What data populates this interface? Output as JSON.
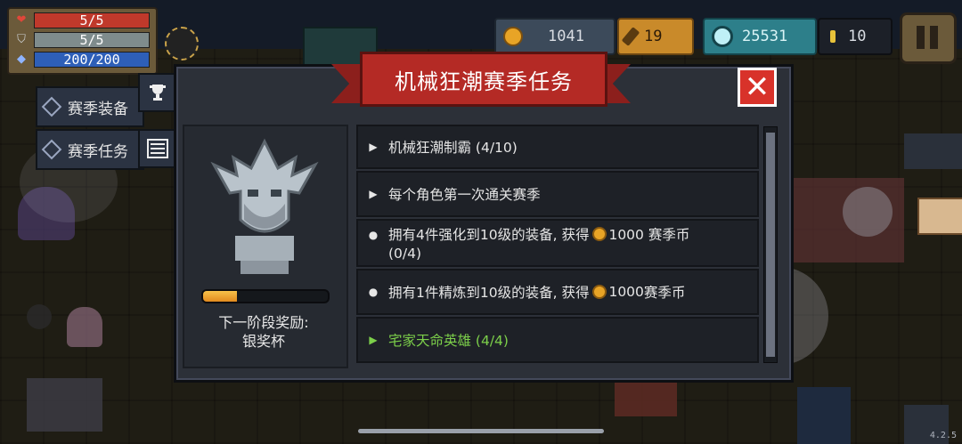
{
  "hud": {
    "hp": "5/5",
    "armor": "5/5",
    "energy": "200/200",
    "colors": {
      "hp": "#c0392b",
      "armor": "#7f8c8d",
      "energy": "#2e5fb8"
    }
  },
  "currencies": {
    "gold": "1041",
    "material": "19",
    "gems": "25531",
    "small": "10"
  },
  "side_tabs": {
    "equipment_label": "赛季装备",
    "tasks_label": "赛季任务"
  },
  "dialog": {
    "title": "机械狂潮赛季任务",
    "reward_label": "下一阶段奖励:",
    "reward_item": "银奖杯",
    "progress_fraction": 0.27,
    "tasks": [
      {
        "marker": "▶",
        "text": "机械狂潮制霸 (4/10)",
        "done": false
      },
      {
        "marker": "▶",
        "text": "每个角色第一次通关赛季",
        "done": false
      },
      {
        "marker": "●",
        "text_before": "拥有4件强化到10级的装备, 获得",
        "amount": "1000",
        "text_after": " 赛季币",
        "extra": "(0/4)",
        "done": false
      },
      {
        "marker": "●",
        "text_before": "拥有1件精炼到10级的装备, 获得",
        "amount": "1000",
        "text_after": " 赛季币",
        "done": false
      },
      {
        "marker": "▶",
        "text": "宅家天命英雄 (4/4)",
        "done": true
      }
    ]
  },
  "version": "4.2.5"
}
